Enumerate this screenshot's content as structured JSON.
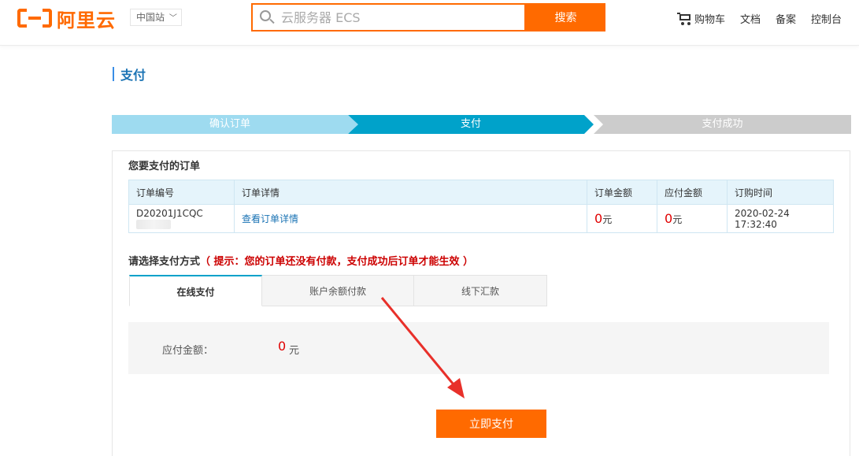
{
  "header": {
    "logo_text": "阿里云",
    "site_selector": "中国站",
    "search_placeholder": "云服务器 ECS",
    "search_button": "搜索",
    "nav": {
      "cart": "购物车",
      "docs": "文档",
      "filing": "备案",
      "console": "控制台"
    }
  },
  "page_title": "支付",
  "steps": [
    "确认订单",
    "支付",
    "支付成功"
  ],
  "order_section": {
    "title": "您要支付的订单",
    "columns": [
      "订单编号",
      "订单详情",
      "订单金额",
      "应付金额",
      "订购时间"
    ],
    "rows": [
      {
        "order_no": "D20201J1CQC",
        "detail_link": "查看订单详情",
        "order_amount": "0",
        "order_amount_unit": "元",
        "payable_amount": "0",
        "payable_amount_unit": "元",
        "order_time": "2020-02-24 17:32:40"
      }
    ]
  },
  "payment": {
    "title": "请选择支付方式",
    "hint": "（ 提示：您的订单还没有付款，支付成功后订单才能生效 ）",
    "tabs": [
      "在线支付",
      "账户余额付款",
      "线下汇款"
    ],
    "active_tab": "在线支付",
    "payable_label": "应付金额：",
    "payable_value": "0",
    "payable_unit": "元",
    "pay_button": "立即支付"
  },
  "colors": {
    "brand": "#ff6a00",
    "step_active": "#00a2ca",
    "step_done": "#9edbf0",
    "step_pending": "#cccccc",
    "amount": "#e00000",
    "annotation_arrow": "#e8302a"
  }
}
